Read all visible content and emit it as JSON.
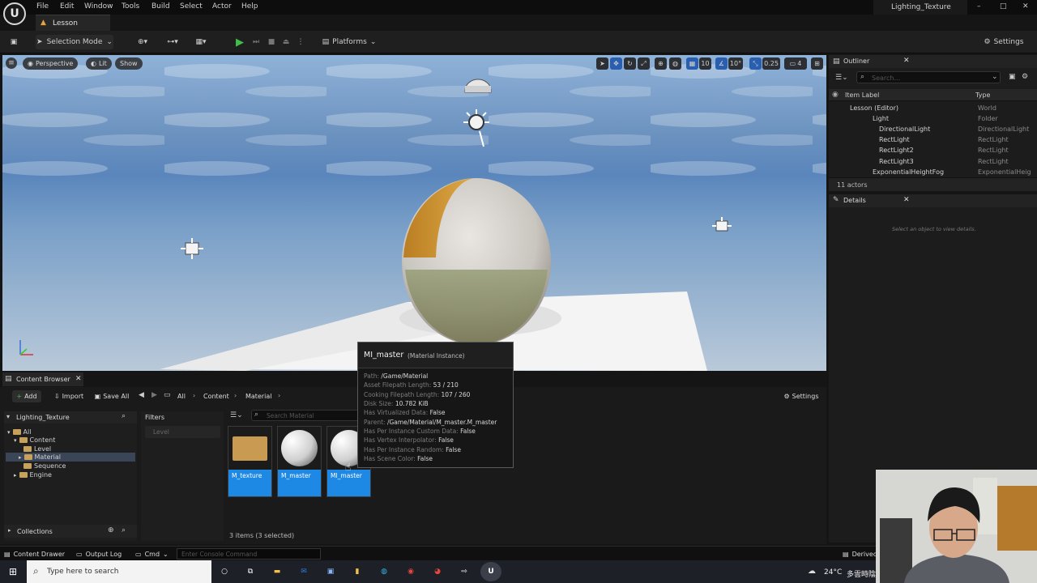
{
  "menu": {
    "items": [
      "File",
      "Edit",
      "Window",
      "Tools",
      "Build",
      "Select",
      "Actor",
      "Help"
    ],
    "project": "Lighting_Texture"
  },
  "doc_tab": {
    "label": "Lesson"
  },
  "toolbar": {
    "selection_mode": "Selection Mode",
    "platforms": "Platforms",
    "settings": "Settings"
  },
  "viewport": {
    "perspective": "Perspective",
    "lit": "Lit",
    "show": "Show",
    "grid_snap": "10",
    "rotation_snap": "10°",
    "scale_snap": "0.25",
    "camera_speed": "4"
  },
  "outliner": {
    "title": "Outliner",
    "search_placeholder": "Search...",
    "col_label": "Item Label",
    "col_type": "Type",
    "rows": [
      {
        "name": "Lesson (Editor)",
        "type": "World"
      },
      {
        "name": "Light",
        "type": "Folder"
      },
      {
        "name": "DirectionalLight",
        "type": "DirectionalLight"
      },
      {
        "name": "RectLight",
        "type": "RectLight"
      },
      {
        "name": "RectLight2",
        "type": "RectLight"
      },
      {
        "name": "RectLight3",
        "type": "RectLight"
      },
      {
        "name": "ExponentialHeightFog",
        "type": "ExponentialHeig"
      }
    ],
    "count": "11 actors"
  },
  "details": {
    "title": "Details",
    "empty_text": "Select an object to view details."
  },
  "content_browser": {
    "tab": "Content Browser",
    "add": "Add",
    "import": "Import",
    "save_all": "Save All",
    "path": [
      "All",
      "Content",
      "Material"
    ],
    "settings": "Settings",
    "project_root": "Lighting_Texture",
    "tree": [
      "All",
      "Content",
      "Level",
      "Material",
      "Sequence",
      "Engine"
    ],
    "filters_title": "Filters",
    "filter_level": "Level",
    "search_placeholder": "Search Material",
    "assets": [
      "M_texture",
      "M_master",
      "MI_master"
    ],
    "items_count": "3 items (3 selected)",
    "collections": "Collections"
  },
  "tooltip": {
    "title": "MI_master",
    "subtitle": "(Material Instance)",
    "rows": [
      {
        "k": "Path:",
        "v": "/Game/Material"
      },
      {
        "k": "Asset Filepath Length:",
        "v": "53 / 210"
      },
      {
        "k": "Cooking Filepath Length:",
        "v": "107 / 260"
      },
      {
        "k": "Disk Size:",
        "v": "10.782 KiB"
      },
      {
        "k": "Has Virtualized Data:",
        "v": "False"
      },
      {
        "k": "Parent:",
        "v": "/Game/Material/M_master.M_master"
      },
      {
        "k": "Has Per Instance Custom Data:",
        "v": "False"
      },
      {
        "k": "Has Vertex Interpolator:",
        "v": "False"
      },
      {
        "k": "Has Per Instance Random:",
        "v": "False"
      },
      {
        "k": "Has Scene Color:",
        "v": "False"
      }
    ]
  },
  "statusbar": {
    "content_drawer": "Content Drawer",
    "output_log": "Output Log",
    "cmd": "Cmd",
    "console_placeholder": "Enter Console Command",
    "derived": "Derived"
  },
  "taskbar": {
    "search_placeholder": "Type here to search",
    "temperature": "24°C",
    "weather": "多雲時陰"
  }
}
